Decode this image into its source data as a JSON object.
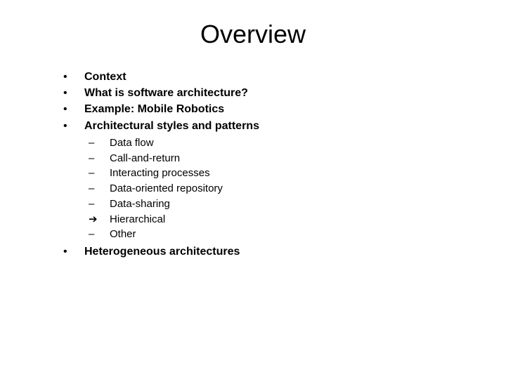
{
  "title": "Overview",
  "items": [
    {
      "bullet": "•",
      "text": "Context"
    },
    {
      "bullet": "•",
      "text": "What is software architecture?"
    },
    {
      "bullet": "•",
      "text": "Example: Mobile Robotics"
    },
    {
      "bullet": "•",
      "text": "Architectural styles and patterns"
    }
  ],
  "subitems": [
    {
      "bullet": "–",
      "text": "Data flow"
    },
    {
      "bullet": "–",
      "text": "Call-and-return"
    },
    {
      "bullet": "–",
      "text": "Interacting processes"
    },
    {
      "bullet": "–",
      "text": "Data-oriented repository"
    },
    {
      "bullet": "–",
      "text": "Data-sharing"
    },
    {
      "bullet": "➔",
      "text": "Hierarchical"
    },
    {
      "bullet": "–",
      "text": "Other"
    }
  ],
  "items2": [
    {
      "bullet": "•",
      "text": "Heterogeneous architectures"
    }
  ]
}
